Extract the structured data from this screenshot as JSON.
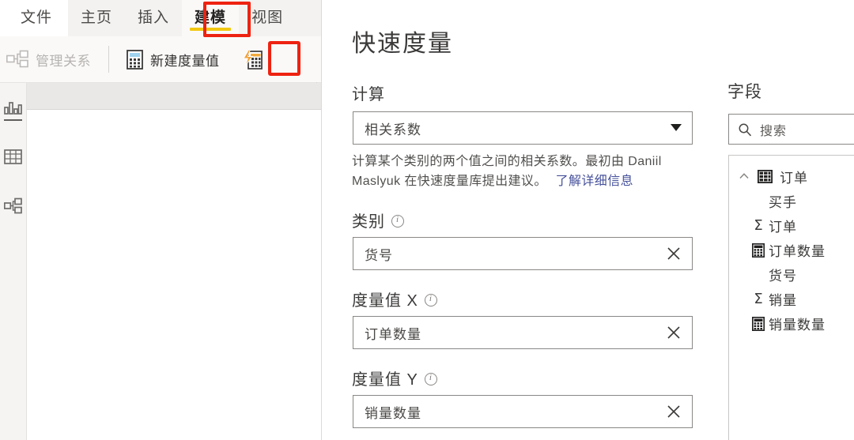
{
  "app": {
    "ribbon_tabs": [
      {
        "label": "文件",
        "active": false,
        "first": true
      },
      {
        "label": "主页",
        "active": false,
        "first": false
      },
      {
        "label": "插入",
        "active": false,
        "first": false
      },
      {
        "label": "建模",
        "active": true,
        "first": false
      },
      {
        "label": "视图",
        "active": false,
        "first": false
      }
    ],
    "ribbon_commands": [
      {
        "label": "管理关系",
        "icon": "manage-relationships-icon",
        "disabled": true
      },
      {
        "label": "新建度量值",
        "icon": "new-measure-calculator-icon",
        "disabled": false
      },
      {
        "label": "",
        "icon": "quick-measure-icon",
        "disabled": false
      }
    ],
    "view_rail": [
      {
        "icon": "report-view-bar-chart-icon",
        "selected": true
      },
      {
        "icon": "data-view-table-icon",
        "selected": false
      },
      {
        "icon": "model-view-relationship-icon",
        "selected": false
      }
    ],
    "annotation_color": "#ee2211",
    "active_tab_underline_color": "#f2c811"
  },
  "dialog": {
    "title": "快速度量",
    "calculation": {
      "label": "计算",
      "selected": "相关系数",
      "description": "计算某个类别的两个值之间的相关系数。最初由 Daniil Maslyuk 在快速度量库提出建议。",
      "link_text": "了解详细信息",
      "link_color": "#46519b"
    },
    "wells": [
      {
        "label": "类别",
        "value": "货号",
        "clear_icon": "close-icon",
        "info_icon": "info-icon"
      },
      {
        "label": "度量值 X",
        "value": "订单数量",
        "clear_icon": "close-icon",
        "info_icon": "info-icon"
      },
      {
        "label": "度量值 Y",
        "value": "销量数量",
        "clear_icon": "close-icon",
        "info_icon": "info-icon"
      }
    ]
  },
  "fields_pane": {
    "title": "字段",
    "search": {
      "placeholder": "搜索",
      "icon": "search-icon",
      "value": ""
    },
    "tables": [
      {
        "name": "订单",
        "expanded": true,
        "chevron_icon": "chevron-up-icon",
        "table_icon": "table-icon",
        "fields": [
          {
            "name": "买手",
            "icon": "none"
          },
          {
            "name": "订单",
            "icon": "sigma-icon"
          },
          {
            "name": "订单数量",
            "icon": "measure-calculator-icon"
          },
          {
            "name": "货号",
            "icon": "none"
          },
          {
            "name": "销量",
            "icon": "sigma-icon"
          },
          {
            "name": "销量数量",
            "icon": "measure-calculator-icon"
          }
        ]
      }
    ]
  }
}
